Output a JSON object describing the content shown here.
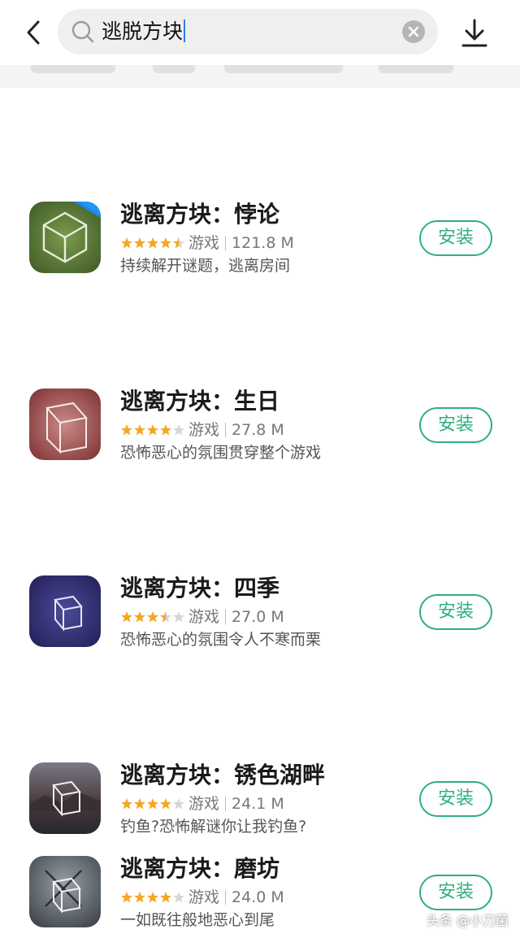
{
  "search": {
    "query": "逃脱方块"
  },
  "icons": {
    "back": "back-arrow-icon",
    "search": "search-icon",
    "clear": "clear-icon",
    "download": "download-icon"
  },
  "colors": {
    "accent": "#2fb07b",
    "star": "#f5a623",
    "star_empty": "#d6d6d6"
  },
  "results": [
    {
      "title": "逃离方块：悖论",
      "rating": 4.5,
      "category": "游戏",
      "size": "121.8 M",
      "description": "持续解开谜题，逃离房间",
      "install_label": "安装",
      "badge": "中文"
    },
    {
      "title": "逃离方块：生日",
      "rating": 4,
      "category": "游戏",
      "size": "27.8 M",
      "description": "恐怖恶心的氛围贯穿整个游戏",
      "install_label": "安装"
    },
    {
      "title": "逃离方块：四季",
      "rating": 3.5,
      "category": "游戏",
      "size": "27.0 M",
      "description": "恐怖恶心的氛围令人不寒而栗",
      "install_label": "安装"
    },
    {
      "title": "逃离方块：锈色湖畔",
      "rating": 4,
      "category": "游戏",
      "size": "24.1 M",
      "description": "钓鱼?恐怖解谜你让我钓鱼?",
      "install_label": "安装"
    },
    {
      "title": "逃离方块：磨坊",
      "rating": 4,
      "category": "游戏",
      "size": "24.0 M",
      "description": "一如既往般地恶心到尾",
      "install_label": "安装"
    }
  ],
  "watermark": "头条 @小刀菌"
}
